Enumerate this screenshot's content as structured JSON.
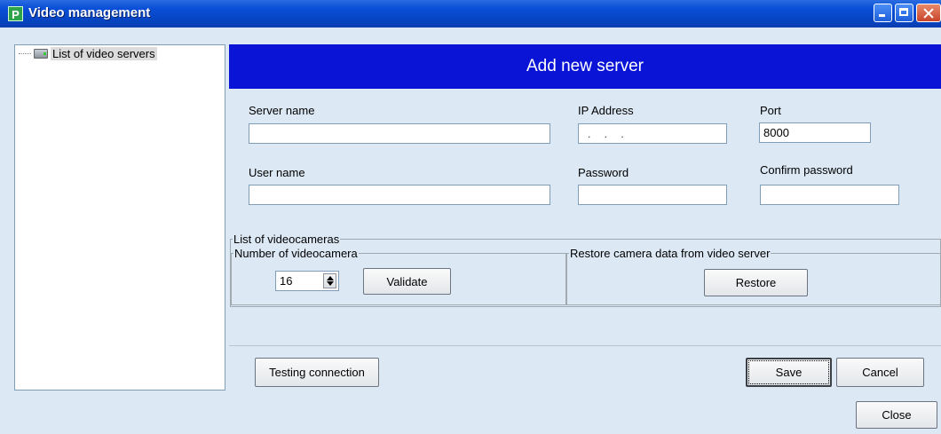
{
  "window": {
    "app_icon_letter": "P",
    "title": "Video management"
  },
  "tree": {
    "items": [
      {
        "label": "List of video servers",
        "icon": "server-icon"
      }
    ]
  },
  "form": {
    "header": "Add new server",
    "server_name": {
      "label": "Server name",
      "value": ""
    },
    "ip_address": {
      "label": "IP Address",
      "value": ". . ."
    },
    "port": {
      "label": "Port",
      "value": "8000"
    },
    "user_name": {
      "label": "User name",
      "value": ""
    },
    "password": {
      "label": "Password",
      "value": ""
    },
    "confirm_password": {
      "label": "Confirm password",
      "value": ""
    }
  },
  "cameras": {
    "group_title": "List of videocameras",
    "number_group_title": "Number of videocamera",
    "number_value": "16",
    "validate_label": "Validate",
    "restore_group_title": "Restore camera data from video server",
    "restore_label": "Restore"
  },
  "actions": {
    "testing_label": "Testing connection",
    "save_label": "Save",
    "cancel_label": "Cancel",
    "close_label": "Close"
  },
  "colors": {
    "title_bar": "#0645c4",
    "header_bg": "#0a14d6",
    "panel_bg": "#dce8f4"
  }
}
